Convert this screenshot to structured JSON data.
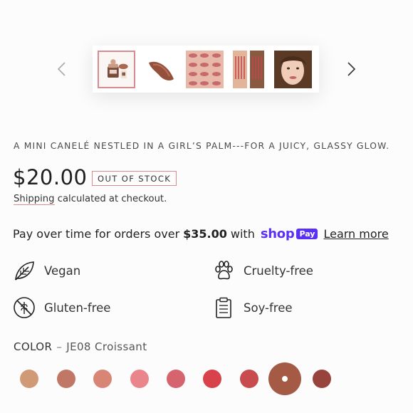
{
  "carousel": {
    "thumbnails": [
      {
        "name": "product-packshot",
        "selected": true
      },
      {
        "name": "lip-texture-smear",
        "selected": false
      },
      {
        "name": "lip-swatch-grid",
        "selected": false
      },
      {
        "name": "arm-swatches",
        "selected": false
      },
      {
        "name": "model-portrait",
        "selected": false
      }
    ]
  },
  "product": {
    "tagline": "A MINI CANELÉ NESTLED IN A GIRL’S PALM---FOR A JUICY, GLASSY GLOW.",
    "price": "$20.00",
    "stock_badge": "OUT OF STOCK",
    "shipping_link": "Shipping",
    "shipping_rest": " calculated at checkout."
  },
  "installments": {
    "prefix": "Pay over time for orders over",
    "threshold": "$35.00",
    "with": "with",
    "shop_word": "shop",
    "pay_word": "Pay",
    "learn_more": "Learn more"
  },
  "attributes": [
    {
      "label": "Vegan",
      "icon": "leaf-icon"
    },
    {
      "label": "Cruelty-free",
      "icon": "paw-icon"
    },
    {
      "label": "Gluten-free",
      "icon": "wheat-icon"
    },
    {
      "label": "Soy-free",
      "icon": "clipboard-icon"
    }
  ],
  "color": {
    "label": "COLOR",
    "separator": "–",
    "selected": "JE08 Croissant",
    "swatches": [
      {
        "hex": "#d09a76"
      },
      {
        "hex": "#c07766"
      },
      {
        "hex": "#d98576"
      },
      {
        "hex": "#e9868c"
      },
      {
        "hex": "#d6646f"
      },
      {
        "hex": "#d8434b"
      },
      {
        "hex": "#c84b4d"
      },
      {
        "hex": "#a45a44",
        "selected": true
      },
      {
        "hex": "#98443c"
      }
    ]
  },
  "colors": {
    "accent_border": "#d98b92",
    "shop_purple": "#5a31f4"
  }
}
